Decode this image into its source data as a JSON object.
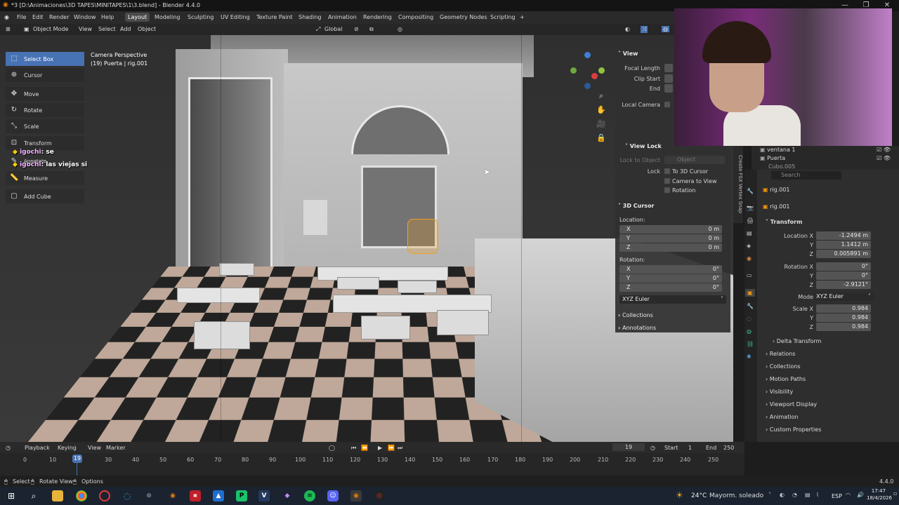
{
  "window": {
    "title": "*3 [D:\\Animaciones\\3D TAPES\\MINITAPES\\1\\3.blend] - Blender 4.4.0",
    "minimize": "—",
    "maximize": "❐",
    "close": "✕"
  },
  "menu": {
    "items": [
      "File",
      "Edit",
      "Render",
      "Window",
      "Help"
    ],
    "workspaces": [
      "Layout",
      "Modeling",
      "Sculpting",
      "UV Editing",
      "Texture Paint",
      "Shading",
      "Animation",
      "Rendering",
      "Compositing",
      "Geometry Nodes",
      "Scripting"
    ],
    "active_workspace": "Layout",
    "add_ws": "+"
  },
  "viewport_header": {
    "mode": "Object Mode",
    "view": "View",
    "select": "Select",
    "add": "Add",
    "object": "Object",
    "orientation": "Global"
  },
  "viewport_info": {
    "line1": "Camera Perspective",
    "line2": "(19) Puerta | rig.001"
  },
  "tools": [
    "Select Box",
    "Cursor",
    "Move",
    "Rotate",
    "Scale",
    "Transform",
    "Annotate",
    "Measure",
    "Add Cube"
  ],
  "chat": [
    {
      "name": "igochi",
      "text": ": se"
    },
    {
      "name": "igochi",
      "text": ": las viejas si"
    }
  ],
  "npanel": {
    "view": "View",
    "focal": "Focal Length",
    "clip_start": "Clip Start",
    "end": "End",
    "local_camera": "Local Camera",
    "view_lock": "View Lock",
    "lock_to_object": "Lock to Object",
    "object_ph": "Object",
    "lock": "Lock",
    "to_cursor": "To 3D Cursor",
    "cam_to_view": "Camera to View",
    "rotation": "Rotation",
    "cursor": "3D Cursor",
    "location": "Location:",
    "rot_label": "Rotation:",
    "cursor_loc": {
      "x": "0 m",
      "y": "0 m",
      "z": "0 m"
    },
    "cursor_rot": {
      "x": "0°",
      "y": "0°",
      "z": "0°"
    },
    "rot_mode": "XYZ Euler",
    "collections": "Collections",
    "annotations": "Annotations"
  },
  "side_tabs": "Create  FSX Vertex Snap",
  "outliner": {
    "rows": [
      "ventana 1",
      "Puerta",
      "Cubo.005"
    ]
  },
  "properties": {
    "search": "Search",
    "object_name": "rig.001",
    "data_name": "rig.001",
    "transform": "Transform",
    "location": {
      "x": "-1.2494 m",
      "y": "1.1412 m",
      "z": "0.005891 m"
    },
    "rotation": {
      "x": "0°",
      "y": "0°",
      "z": "-2.9121°"
    },
    "mode_label": "Mode",
    "mode": "XYZ Euler",
    "scale": {
      "x": "0.984",
      "y": "0.984",
      "z": "0.984"
    },
    "labels": {
      "loc_x": "Location X",
      "rot_x": "Rotation X",
      "scale_x": "Scale X",
      "y": "Y",
      "z": "Z"
    },
    "delta": "Delta Transform",
    "panels": [
      "Relations",
      "Collections",
      "Motion Paths",
      "Visibility",
      "Viewport Display",
      "Animation",
      "Custom Properties"
    ]
  },
  "timeline": {
    "playback": "Playback",
    "keying": "Keying",
    "view": "View",
    "marker": "Marker",
    "current": "19",
    "start_label": "Start",
    "start": "1",
    "end_label": "End",
    "end": "250",
    "ticks": [
      "0",
      "10",
      "19",
      "30",
      "40",
      "50",
      "60",
      "70",
      "80",
      "90",
      "100",
      "110",
      "120",
      "130",
      "140",
      "150",
      "160",
      "170",
      "180",
      "190",
      "200",
      "210",
      "220",
      "230",
      "240",
      "250"
    ]
  },
  "status": {
    "select": "Select",
    "rotate": "Rotate View",
    "options": "Options",
    "version": "4.4.0"
  },
  "taskbar": {
    "weather_temp": "24°C",
    "weather_text": "Mayorm. soleado",
    "lang": "ESP",
    "time": "17:47",
    "date": "18/4/2026"
  }
}
